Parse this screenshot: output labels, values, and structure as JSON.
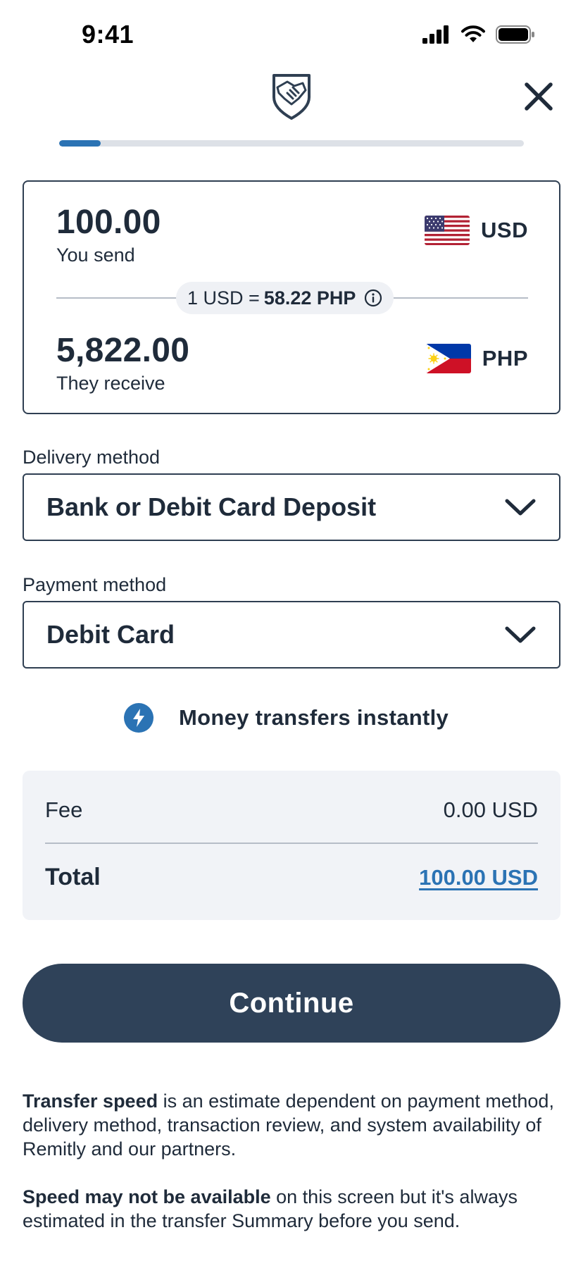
{
  "status_bar": {
    "time": "9:41"
  },
  "header": {
    "logo_icon": "handshake-shield-icon",
    "close_icon": "close-icon"
  },
  "progress": {
    "fraction": 0.09
  },
  "send": {
    "amount": "100.00",
    "label": "You send",
    "currency": "USD",
    "flag": "us-flag-icon"
  },
  "rate": {
    "prefix": "1 USD =",
    "value": "58.22 PHP",
    "icon": "info-icon"
  },
  "receive": {
    "amount": "5,822.00",
    "label": "They receive",
    "currency": "PHP",
    "flag": "ph-flag-icon"
  },
  "delivery": {
    "label": "Delivery method",
    "value": "Bank or Debit Card Deposit"
  },
  "payment": {
    "label": "Payment method",
    "value": "Debit Card"
  },
  "speed": {
    "text": "Money transfers instantly",
    "icon": "lightning-bolt-icon"
  },
  "summary": {
    "fee_label": "Fee",
    "fee_value": "0.00 USD",
    "total_label": "Total",
    "total_value": "100.00 USD"
  },
  "continue_label": "Continue",
  "disclaimer": {
    "p1_bold": "Transfer speed",
    "p1_rest": " is an estimate dependent on payment method, delivery method, transaction review, and system availability of Remitly and our partners.",
    "p2_bold": "Speed may not be available",
    "p2_rest": " on this screen but it's always estimated in the transfer Summary before you send."
  },
  "colors": {
    "accent": "#2b73b4",
    "primary_button": "#2f4259",
    "text": "#1f2b3a",
    "summary_bg": "#f1f3f7"
  }
}
